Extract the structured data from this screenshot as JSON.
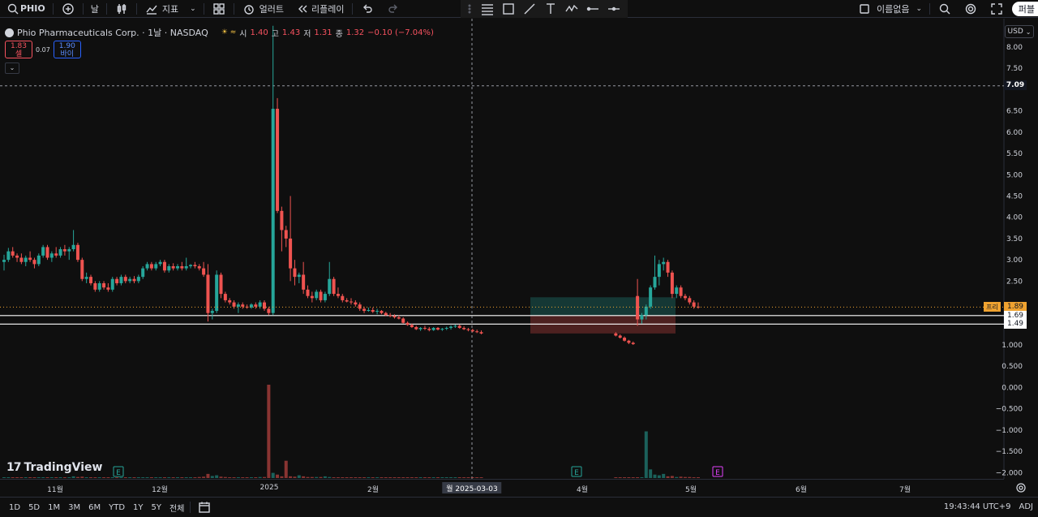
{
  "toolbar": {
    "symbol": "PHIO",
    "interval": "날",
    "indicators_label": "지표",
    "alert_label": "얼러트",
    "replay_label": "리플레이",
    "layout_name": "이름없음",
    "publish_label": "퍼블"
  },
  "legend": {
    "title": "Phio Pharmaceuticals Corp. · 1날 · NASDAQ",
    "market_status_icon": "sun-icon",
    "open_label": "시",
    "open": "1.40",
    "high_label": "고",
    "high": "1.43",
    "low_label": "저",
    "low": "1.31",
    "close_label": "종",
    "close": "1.32",
    "change": "−0.10 (−7.04%)",
    "sell_price": "1.83",
    "sell_label": "셀",
    "spread": "0.07",
    "buy_price": "1.90",
    "buy_label": "바이"
  },
  "price_axis": {
    "currency": "USD",
    "ticks": [
      "8.00",
      "7.50",
      "6.50",
      "6.00",
      "5.50",
      "5.00",
      "4.50",
      "4.00",
      "3.50",
      "3.00",
      "2.50",
      "1.000",
      "0.500",
      "0.000",
      "−0.500",
      "−1.000",
      "−1.500",
      "−2.000"
    ],
    "crosshair_price": "7.09",
    "last_price": "1.89",
    "last_price_left_label": "프리",
    "level1": "1.69",
    "level2": "1.49"
  },
  "time_axis": {
    "labels": [
      "11월",
      "12월",
      "2025",
      "2월",
      "4월",
      "5월",
      "6월",
      "7월"
    ],
    "crosshair_date_prefix": "월",
    "crosshair_date": "2025-03-03",
    "earnings_markers": [
      "E",
      "E",
      "E"
    ]
  },
  "branding": {
    "logo_text": "TradingView"
  },
  "bottombar": {
    "ranges": [
      "1D",
      "5D",
      "1M",
      "3M",
      "6M",
      "YTD",
      "1Y",
      "5Y",
      "전체"
    ],
    "clock": "19:43:44 UTC+9",
    "adj": "ADJ"
  },
  "colors": {
    "up": "#26a69a",
    "down": "#ef5350",
    "background": "#0f0f0f",
    "last_price": "#f0a330"
  },
  "chart_data": {
    "type": "candlestick",
    "symbol": "PHIO",
    "interval": "1D",
    "ylim": [
      -2.1,
      8.3
    ],
    "candles": [
      {
        "o": 2.95,
        "h": 3.12,
        "l": 2.75,
        "c": 3.0
      },
      {
        "o": 3.0,
        "h": 3.28,
        "l": 2.95,
        "c": 3.2
      },
      {
        "o": 3.2,
        "h": 3.3,
        "l": 3.05,
        "c": 3.1
      },
      {
        "o": 3.1,
        "h": 3.15,
        "l": 2.95,
        "c": 3.05
      },
      {
        "o": 3.05,
        "h": 3.15,
        "l": 2.9,
        "c": 2.95
      },
      {
        "o": 2.95,
        "h": 3.1,
        "l": 2.85,
        "c": 3.05
      },
      {
        "o": 3.05,
        "h": 3.2,
        "l": 2.95,
        "c": 3.0
      },
      {
        "o": 3.0,
        "h": 3.05,
        "l": 2.8,
        "c": 2.9
      },
      {
        "o": 2.9,
        "h": 3.15,
        "l": 2.85,
        "c": 3.1
      },
      {
        "o": 3.1,
        "h": 3.35,
        "l": 3.05,
        "c": 3.3
      },
      {
        "o": 3.3,
        "h": 3.35,
        "l": 3.0,
        "c": 3.05
      },
      {
        "o": 3.05,
        "h": 3.2,
        "l": 2.95,
        "c": 3.15
      },
      {
        "o": 3.15,
        "h": 3.3,
        "l": 3.05,
        "c": 3.1
      },
      {
        "o": 3.1,
        "h": 3.3,
        "l": 3.05,
        "c": 3.25
      },
      {
        "o": 3.25,
        "h": 3.35,
        "l": 3.1,
        "c": 3.2
      },
      {
        "o": 3.2,
        "h": 3.3,
        "l": 3.0,
        "c": 3.25
      },
      {
        "o": 3.25,
        "h": 3.7,
        "l": 3.2,
        "c": 3.35
      },
      {
        "o": 3.35,
        "h": 3.4,
        "l": 2.95,
        "c": 3.0
      },
      {
        "o": 3.0,
        "h": 3.05,
        "l": 2.5,
        "c": 2.55
      },
      {
        "o": 2.55,
        "h": 2.7,
        "l": 2.45,
        "c": 2.6
      },
      {
        "o": 2.6,
        "h": 2.65,
        "l": 2.4,
        "c": 2.45
      },
      {
        "o": 2.45,
        "h": 2.5,
        "l": 2.25,
        "c": 2.3
      },
      {
        "o": 2.3,
        "h": 2.5,
        "l": 2.25,
        "c": 2.45
      },
      {
        "o": 2.45,
        "h": 2.5,
        "l": 2.3,
        "c": 2.35
      },
      {
        "o": 2.35,
        "h": 2.45,
        "l": 2.25,
        "c": 2.3
      },
      {
        "o": 2.3,
        "h": 2.6,
        "l": 2.25,
        "c": 2.55
      },
      {
        "o": 2.55,
        "h": 2.6,
        "l": 2.4,
        "c": 2.45
      },
      {
        "o": 2.45,
        "h": 2.65,
        "l": 2.4,
        "c": 2.6
      },
      {
        "o": 2.6,
        "h": 2.65,
        "l": 2.45,
        "c": 2.5
      },
      {
        "o": 2.5,
        "h": 2.6,
        "l": 2.45,
        "c": 2.55
      },
      {
        "o": 2.55,
        "h": 2.62,
        "l": 2.45,
        "c": 2.5
      },
      {
        "o": 2.5,
        "h": 2.65,
        "l": 2.45,
        "c": 2.6
      },
      {
        "o": 2.6,
        "h": 2.85,
        "l": 2.55,
        "c": 2.8
      },
      {
        "o": 2.8,
        "h": 2.95,
        "l": 2.75,
        "c": 2.9
      },
      {
        "o": 2.9,
        "h": 2.95,
        "l": 2.75,
        "c": 2.8
      },
      {
        "o": 2.8,
        "h": 2.95,
        "l": 2.75,
        "c": 2.9
      },
      {
        "o": 2.9,
        "h": 3.0,
        "l": 2.85,
        "c": 2.95
      },
      {
        "o": 2.95,
        "h": 3.0,
        "l": 2.7,
        "c": 2.75
      },
      {
        "o": 2.75,
        "h": 2.9,
        "l": 2.7,
        "c": 2.85
      },
      {
        "o": 2.85,
        "h": 2.92,
        "l": 2.75,
        "c": 2.8
      },
      {
        "o": 2.8,
        "h": 2.9,
        "l": 2.75,
        "c": 2.85
      },
      {
        "o": 2.85,
        "h": 2.95,
        "l": 2.75,
        "c": 2.8
      },
      {
        "o": 2.8,
        "h": 3.05,
        "l": 2.75,
        "c": 2.85
      },
      {
        "o": 2.85,
        "h": 2.9,
        "l": 2.8,
        "c": 2.88
      },
      {
        "o": 2.88,
        "h": 2.95,
        "l": 2.8,
        "c": 2.85
      },
      {
        "o": 2.85,
        "h": 2.9,
        "l": 2.75,
        "c": 2.8
      },
      {
        "o": 2.8,
        "h": 2.95,
        "l": 2.6,
        "c": 2.65
      },
      {
        "o": 2.65,
        "h": 2.9,
        "l": 1.55,
        "c": 1.75
      },
      {
        "o": 1.75,
        "h": 1.85,
        "l": 1.6,
        "c": 1.8
      },
      {
        "o": 1.8,
        "h": 2.75,
        "l": 1.75,
        "c": 2.65
      },
      {
        "o": 2.65,
        "h": 2.7,
        "l": 2.1,
        "c": 2.2
      },
      {
        "o": 2.2,
        "h": 2.25,
        "l": 2.0,
        "c": 2.05
      },
      {
        "o": 2.05,
        "h": 2.1,
        "l": 1.95,
        "c": 2.0
      },
      {
        "o": 2.0,
        "h": 2.05,
        "l": 1.85,
        "c": 1.9
      },
      {
        "o": 1.9,
        "h": 2.0,
        "l": 1.75,
        "c": 1.95
      },
      {
        "o": 1.95,
        "h": 2.0,
        "l": 1.85,
        "c": 1.9
      },
      {
        "o": 1.9,
        "h": 1.95,
        "l": 1.85,
        "c": 1.88
      },
      {
        "o": 1.88,
        "h": 1.98,
        "l": 1.85,
        "c": 1.95
      },
      {
        "o": 1.95,
        "h": 2.0,
        "l": 1.85,
        "c": 1.9
      },
      {
        "o": 1.9,
        "h": 2.05,
        "l": 1.85,
        "c": 2.0
      },
      {
        "o": 2.0,
        "h": 2.05,
        "l": 1.8,
        "c": 1.85
      },
      {
        "o": 1.85,
        "h": 1.9,
        "l": 1.7,
        "c": 1.75
      },
      {
        "o": 1.75,
        "h": 8.5,
        "l": 1.7,
        "c": 6.55
      },
      {
        "o": 6.55,
        "h": 6.8,
        "l": 4.1,
        "c": 4.15
      },
      {
        "o": 4.15,
        "h": 4.25,
        "l": 3.2,
        "c": 3.7
      },
      {
        "o": 3.7,
        "h": 3.8,
        "l": 3.3,
        "c": 3.5
      },
      {
        "o": 3.5,
        "h": 4.5,
        "l": 2.5,
        "c": 2.8
      },
      {
        "o": 2.8,
        "h": 3.0,
        "l": 2.4,
        "c": 2.6
      },
      {
        "o": 2.6,
        "h": 2.7,
        "l": 2.45,
        "c": 2.65
      },
      {
        "o": 2.65,
        "h": 2.95,
        "l": 2.2,
        "c": 2.3
      },
      {
        "o": 2.3,
        "h": 2.4,
        "l": 2.1,
        "c": 2.15
      },
      {
        "o": 2.15,
        "h": 2.25,
        "l": 2.0,
        "c": 2.1
      },
      {
        "o": 2.1,
        "h": 2.3,
        "l": 2.05,
        "c": 2.25
      },
      {
        "o": 2.25,
        "h": 2.3,
        "l": 2.0,
        "c": 2.05
      },
      {
        "o": 2.05,
        "h": 2.25,
        "l": 2.0,
        "c": 2.2
      },
      {
        "o": 2.2,
        "h": 2.95,
        "l": 2.15,
        "c": 2.55
      },
      {
        "o": 2.55,
        "h": 2.6,
        "l": 2.15,
        "c": 2.2
      },
      {
        "o": 2.2,
        "h": 2.35,
        "l": 2.1,
        "c": 2.15
      },
      {
        "o": 2.15,
        "h": 2.2,
        "l": 2.0,
        "c": 2.05
      },
      {
        "o": 2.05,
        "h": 2.1,
        "l": 2.0,
        "c": 2.02
      },
      {
        "o": 2.02,
        "h": 2.1,
        "l": 1.95,
        "c": 2.0
      },
      {
        "o": 2.0,
        "h": 2.05,
        "l": 1.9,
        "c": 1.95
      },
      {
        "o": 1.95,
        "h": 2.0,
        "l": 1.8,
        "c": 1.85
      },
      {
        "o": 1.85,
        "h": 1.9,
        "l": 1.75,
        "c": 1.8
      },
      {
        "o": 1.8,
        "h": 1.88,
        "l": 1.78,
        "c": 1.82
      },
      {
        "o": 1.82,
        "h": 1.88,
        "l": 1.75,
        "c": 1.78
      },
      {
        "o": 1.78,
        "h": 1.85,
        "l": 1.72,
        "c": 1.8
      },
      {
        "o": 1.8,
        "h": 1.82,
        "l": 1.72,
        "c": 1.75
      },
      {
        "o": 1.75,
        "h": 1.78,
        "l": 1.68,
        "c": 1.7
      },
      {
        "o": 1.7,
        "h": 1.75,
        "l": 1.65,
        "c": 1.68
      },
      {
        "o": 1.68,
        "h": 1.72,
        "l": 1.62,
        "c": 1.65
      },
      {
        "o": 1.65,
        "h": 1.7,
        "l": 1.6,
        "c": 1.62
      },
      {
        "o": 1.62,
        "h": 1.65,
        "l": 1.5,
        "c": 1.52
      },
      {
        "o": 1.52,
        "h": 1.55,
        "l": 1.45,
        "c": 1.47
      },
      {
        "o": 1.47,
        "h": 1.5,
        "l": 1.4,
        "c": 1.42
      },
      {
        "o": 1.42,
        "h": 1.45,
        "l": 1.35,
        "c": 1.37
      },
      {
        "o": 1.37,
        "h": 1.42,
        "l": 1.33,
        "c": 1.4
      },
      {
        "o": 1.4,
        "h": 1.45,
        "l": 1.35,
        "c": 1.38
      },
      {
        "o": 1.38,
        "h": 1.42,
        "l": 1.32,
        "c": 1.35
      },
      {
        "o": 1.35,
        "h": 1.42,
        "l": 1.33,
        "c": 1.4
      },
      {
        "o": 1.4,
        "h": 1.42,
        "l": 1.34,
        "c": 1.36
      },
      {
        "o": 1.36,
        "h": 1.4,
        "l": 1.33,
        "c": 1.38
      },
      {
        "o": 1.38,
        "h": 1.43,
        "l": 1.35,
        "c": 1.4
      },
      {
        "o": 1.4,
        "h": 1.46,
        "l": 1.36,
        "c": 1.43
      },
      {
        "o": 1.43,
        "h": 1.48,
        "l": 1.4,
        "c": 1.45
      },
      {
        "o": 1.45,
        "h": 1.48,
        "l": 1.38,
        "c": 1.4
      },
      {
        "o": 1.4,
        "h": 1.44,
        "l": 1.35,
        "c": 1.37
      },
      {
        "o": 1.37,
        "h": 1.4,
        "l": 1.32,
        "c": 1.35
      },
      {
        "o": 1.35,
        "h": 1.38,
        "l": 1.3,
        "c": 1.32
      },
      {
        "o": 1.32,
        "h": 1.36,
        "l": 1.28,
        "c": 1.3
      },
      {
        "o": 1.3,
        "h": 1.34,
        "l": 1.25,
        "c": 1.27
      },
      {
        "o": 1.27,
        "h": 1.3,
        "l": 1.2,
        "c": 1.22
      },
      {
        "o": 1.22,
        "h": 1.25,
        "l": 1.15,
        "c": 1.17
      },
      {
        "o": 1.17,
        "h": 1.2,
        "l": 1.08,
        "c": 1.1
      },
      {
        "o": 1.1,
        "h": 1.12,
        "l": 1.02,
        "c": 1.05
      },
      {
        "o": 1.05,
        "h": 1.08,
        "l": 1.0,
        "c": 1.02
      },
      {
        "o": 2.15,
        "h": 2.55,
        "l": 1.45,
        "c": 1.6
      },
      {
        "o": 1.6,
        "h": 1.75,
        "l": 1.5,
        "c": 1.7
      },
      {
        "o": 1.7,
        "h": 1.95,
        "l": 1.6,
        "c": 1.9
      },
      {
        "o": 1.9,
        "h": 2.4,
        "l": 1.85,
        "c": 2.35
      },
      {
        "o": 2.35,
        "h": 3.1,
        "l": 2.3,
        "c": 2.6
      },
      {
        "o": 2.6,
        "h": 3.0,
        "l": 2.4,
        "c": 2.9
      },
      {
        "o": 2.9,
        "h": 3.05,
        "l": 2.75,
        "c": 2.95
      },
      {
        "o": 2.95,
        "h": 3.0,
        "l": 2.6,
        "c": 2.7
      },
      {
        "o": 2.7,
        "h": 2.75,
        "l": 2.1,
        "c": 2.2
      },
      {
        "o": 2.2,
        "h": 2.4,
        "l": 2.1,
        "c": 2.35
      },
      {
        "o": 2.35,
        "h": 2.4,
        "l": 2.1,
        "c": 2.15
      },
      {
        "o": 2.15,
        "h": 2.2,
        "l": 2.05,
        "c": 2.1
      },
      {
        "o": 2.1,
        "h": 2.15,
        "l": 1.95,
        "c": 2.0
      },
      {
        "o": 2.0,
        "h": 2.05,
        "l": 1.85,
        "c": 1.9
      },
      {
        "o": 1.9,
        "h": 2.0,
        "l": 1.85,
        "c": 1.89
      }
    ],
    "volume": [
      0.02,
      0.02,
      0.02,
      0.02,
      0.02,
      0.02,
      0.02,
      0.02,
      0.02,
      0.02,
      0.02,
      0.02,
      0.02,
      0.02,
      0.02,
      0.02,
      0.05,
      0.03,
      0.04,
      0.02,
      0.02,
      0.02,
      0.02,
      0.02,
      0.02,
      0.02,
      0.02,
      0.02,
      0.02,
      0.02,
      0.02,
      0.02,
      0.02,
      0.02,
      0.02,
      0.02,
      0.02,
      0.02,
      0.02,
      0.02,
      0.02,
      0.02,
      0.02,
      0.02,
      0.02,
      0.03,
      0.04,
      0.12,
      0.06,
      0.08,
      0.04,
      0.03,
      0.02,
      0.02,
      0.02,
      0.02,
      0.02,
      0.02,
      0.02,
      0.03,
      0.03,
      2.7,
      0.15,
      0.1,
      0.05,
      0.5,
      0.05,
      0.04,
      0.08,
      0.05,
      0.03,
      0.03,
      0.03,
      0.03,
      0.05,
      0.03,
      0.02,
      0.02,
      0.02,
      0.02,
      0.02,
      0.02,
      0.02,
      0.02,
      0.02,
      0.02,
      0.02,
      0.02,
      0.02,
      0.02,
      0.02,
      0.02,
      0.02,
      0.02,
      0.02,
      0.02,
      0.02,
      0.02,
      0.02,
      0.02,
      0.02,
      0.02,
      0.02,
      0.02,
      0.02,
      0.02,
      0.02,
      0.02,
      0.02,
      0.02,
      0.02,
      0.02,
      0.02,
      0.02,
      0.02,
      0.02,
      0.02,
      0.02,
      1.35,
      0.25,
      0.1,
      0.08,
      0.12,
      0.05,
      0.06,
      0.03,
      0.04,
      0.03,
      0.03,
      0.02,
      0.02,
      0.02,
      0.02
    ],
    "horizontal_levels": [
      7.09,
      1.69,
      1.49
    ],
    "position_box": {
      "entry": 1.69,
      "target": 2.12,
      "stop": 1.27
    }
  }
}
